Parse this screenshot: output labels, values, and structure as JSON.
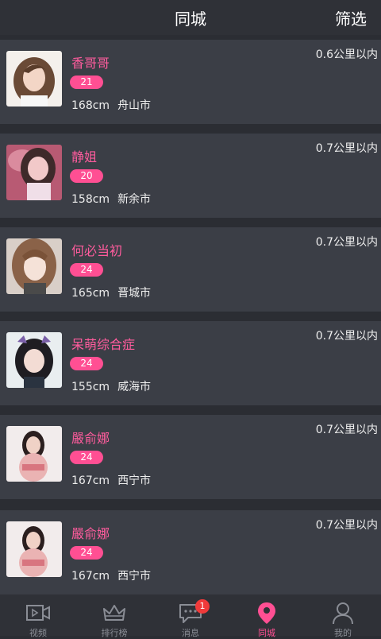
{
  "header": {
    "title": "同城",
    "filter_label": "筛选"
  },
  "users": [
    {
      "name": "香哥哥",
      "age": "21",
      "height": "168cm",
      "city": "舟山市",
      "distance": "0.6公里以内"
    },
    {
      "name": "静姐",
      "age": "20",
      "height": "158cm",
      "city": "新余市",
      "distance": "0.7公里以内"
    },
    {
      "name": "何必当初",
      "age": "24",
      "height": "165cm",
      "city": "晋城市",
      "distance": "0.7公里以内"
    },
    {
      "name": "呆萌综合症",
      "age": "24",
      "height": "155cm",
      "city": "威海市",
      "distance": "0.7公里以内"
    },
    {
      "name": "嚴俞娜",
      "age": "24",
      "height": "167cm",
      "city": "西宁市",
      "distance": "0.7公里以内"
    },
    {
      "name": "嚴俞娜",
      "age": "24",
      "height": "167cm",
      "city": "西宁市",
      "distance": "0.7公里以内"
    }
  ],
  "tabbar": {
    "video": "视频",
    "ranking": "排行榜",
    "messages": "消息",
    "messages_badge": "1",
    "nearby": "同城",
    "mine": "我的"
  },
  "colors": {
    "accent": "#ff4f93",
    "background": "#2b2d33",
    "card": "#3b3e46"
  }
}
